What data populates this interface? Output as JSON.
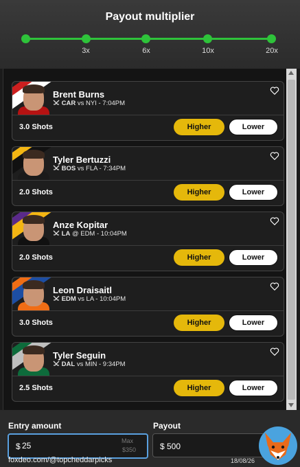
{
  "header": {
    "title": "Payout multiplier",
    "multipliers": [
      "3x",
      "6x",
      "10x",
      "20x"
    ]
  },
  "players": [
    {
      "name": "Brent Burns",
      "team": "CAR",
      "matchup_rest": "vs NYI - 7:04PM",
      "stat": "3.0 Shots",
      "stripe_colors": [
        "#cc1f1f",
        "#ffffff"
      ],
      "jersey_color": "#b51212"
    },
    {
      "name": "Tyler Bertuzzi",
      "team": "BOS",
      "matchup_rest": "vs FLA - 7:34PM",
      "stat": "2.0 Shots",
      "stripe_colors": [
        "#f4b613",
        "#111111"
      ],
      "jersey_color": "#1a1a1a"
    },
    {
      "name": "Anze Kopitar",
      "team": "LA",
      "matchup_rest": "@ EDM - 10:04PM",
      "stat": "2.0 Shots",
      "stripe_colors": [
        "#5a2a8a",
        "#f4b613"
      ],
      "jersey_color": "#111111"
    },
    {
      "name": "Leon Draisaitl",
      "team": "EDM",
      "matchup_rest": "vs LA - 10:04PM",
      "stat": "3.0 Shots",
      "stripe_colors": [
        "#f06d15",
        "#1d4ea3"
      ],
      "jersey_color": "#f06d15"
    },
    {
      "name": "Tyler Seguin",
      "team": "DAL",
      "matchup_rest": "vs MIN - 9:34PM",
      "stat": "2.5 Shots",
      "stripe_colors": [
        "#0d6b3b",
        "#bfbfbf"
      ],
      "jersey_color": "#0d6b3b"
    }
  ],
  "buttons": {
    "higher": "Higher",
    "lower": "Lower"
  },
  "entry": {
    "label": "Entry amount",
    "currency": "$",
    "value": "25",
    "max_label": "Max",
    "max_value": "$350"
  },
  "payout": {
    "label": "Payout",
    "currency": "$",
    "value": "500"
  },
  "watermark": "foxdeo.com/@topcheddarpicks",
  "date": "18/08/26",
  "colors": {
    "accent_green": "#2ec33a",
    "higher_yellow": "#e5b80b",
    "focus_blue": "#5aa1e0"
  },
  "icons": {
    "favorite": "heart-icon",
    "sport": "hockey-sticks-icon",
    "logo": "fox-logo"
  }
}
